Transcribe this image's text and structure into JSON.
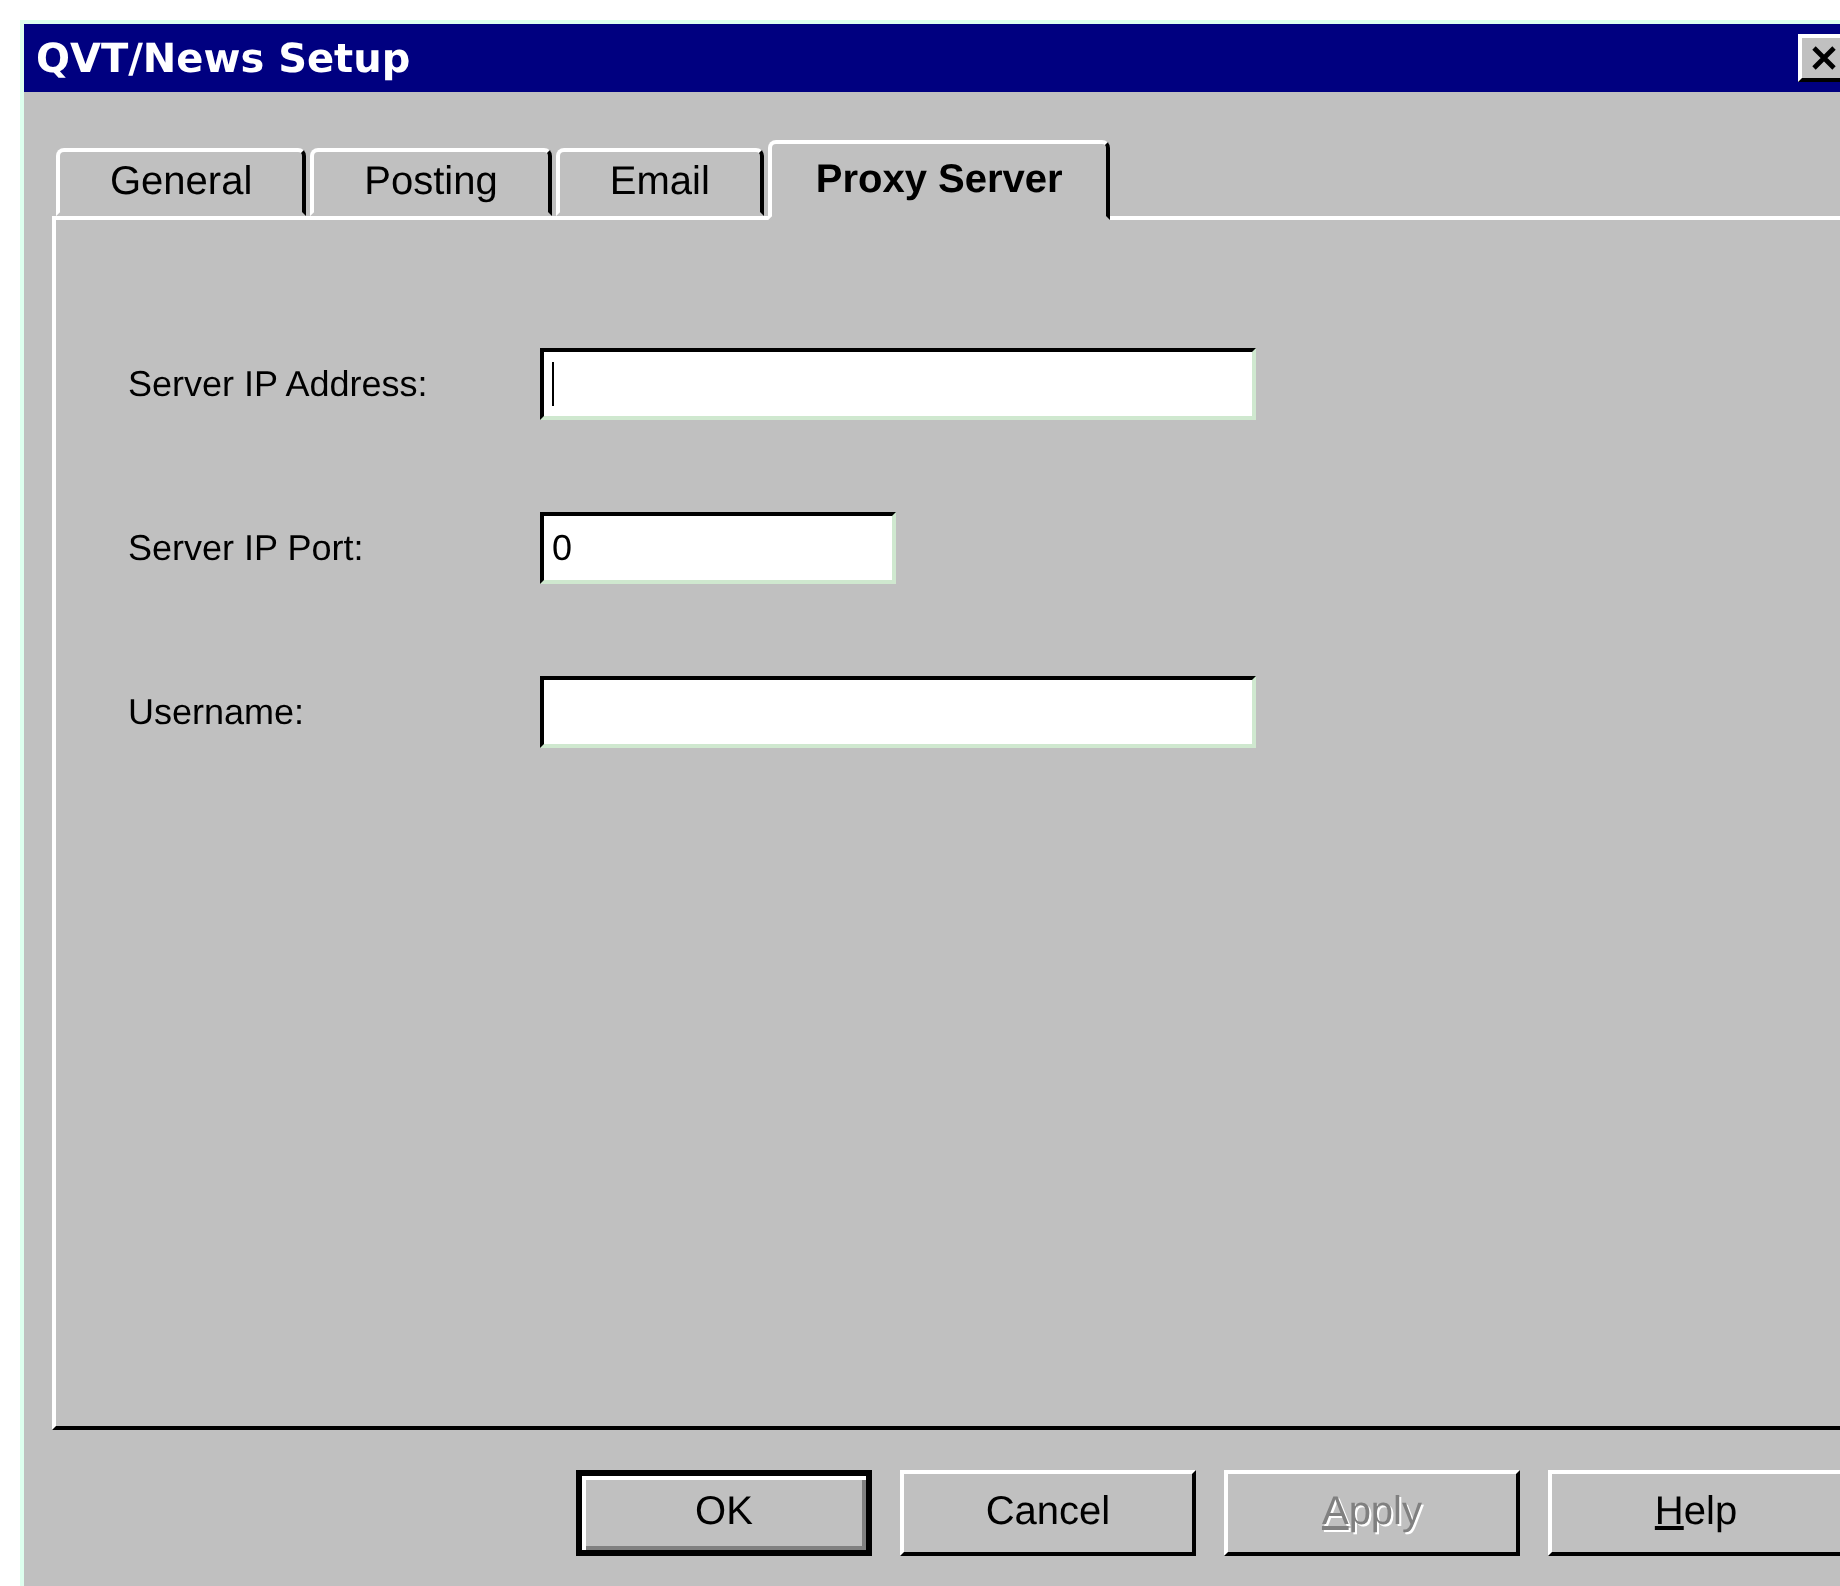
{
  "window": {
    "title": "QVT/News Setup"
  },
  "tabs": [
    {
      "label": "General",
      "selected": false
    },
    {
      "label": "Posting",
      "selected": false
    },
    {
      "label": "Email",
      "selected": false
    },
    {
      "label": "Proxy Server",
      "selected": true
    }
  ],
  "fields": [
    {
      "label": "Server IP Address:",
      "focused": true,
      "kind": "wide"
    },
    {
      "label": "Server IP Port:",
      "value": "0",
      "focused": false,
      "kind": "narrow"
    },
    {
      "label": "Username:",
      "focused": false,
      "kind": "wide"
    }
  ],
  "buttons": [
    {
      "label": "OK",
      "default": true,
      "disabled": false,
      "underline_first": false
    },
    {
      "label": "Cancel",
      "default": false,
      "disabled": false,
      "underline_first": false
    },
    {
      "label": "Apply",
      "default": false,
      "disabled": true,
      "underline_first": true
    },
    {
      "label": "Help",
      "default": false,
      "disabled": false,
      "underline_first": true
    }
  ]
}
